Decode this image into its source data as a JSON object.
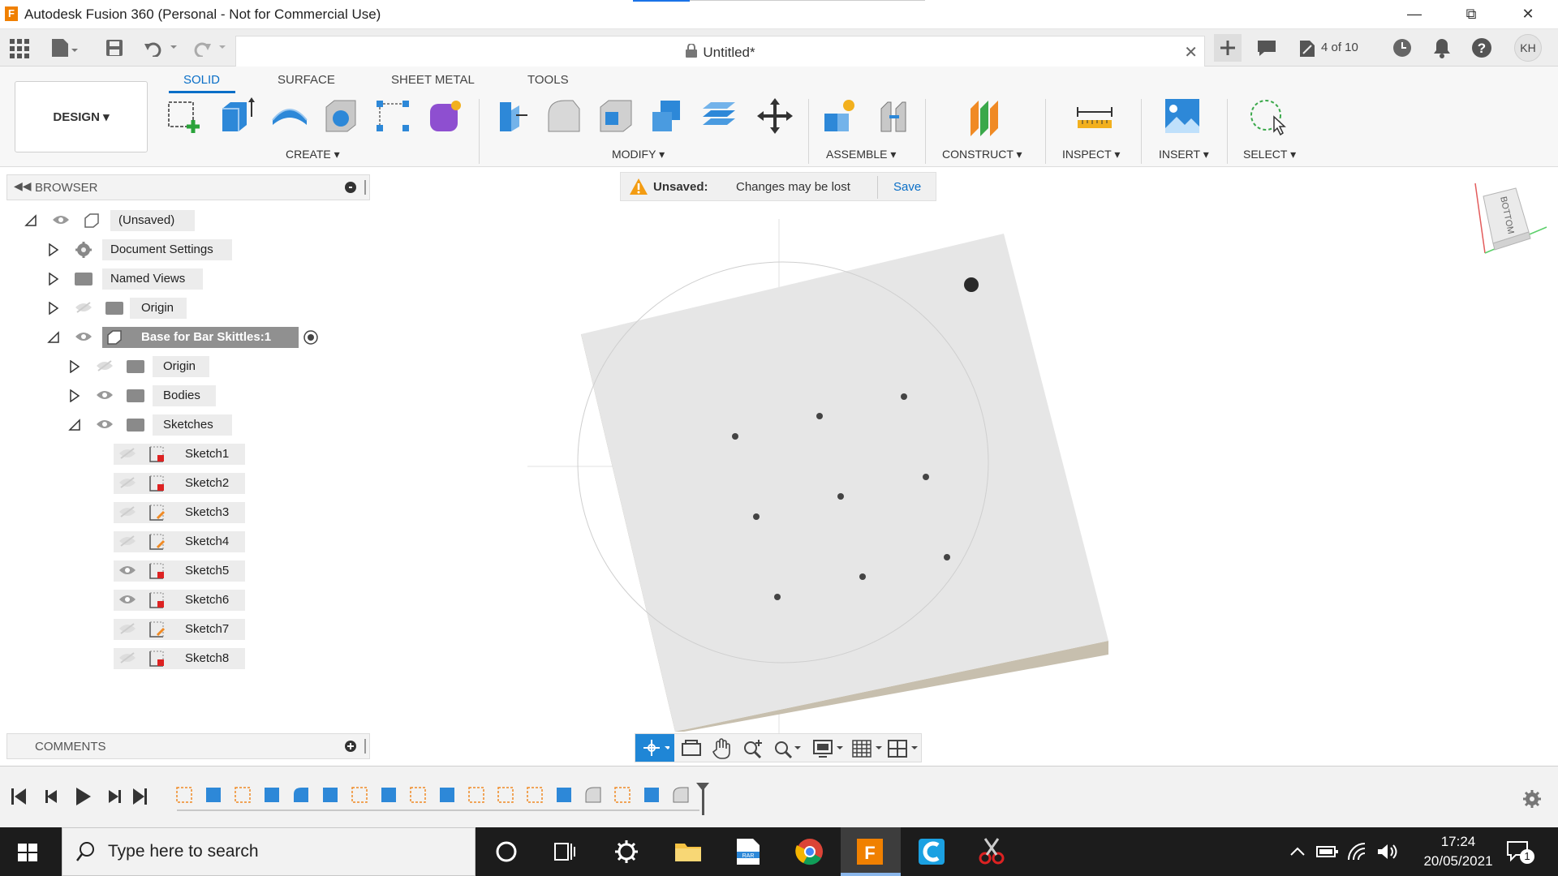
{
  "window": {
    "title": "Autodesk Fusion 360 (Personal - Not for Commercial Use)",
    "app_icon_letter": "F"
  },
  "quickbar": {
    "doc_title": "Untitled*",
    "version": "4 of 10",
    "user_initials": "KH"
  },
  "ribbon": {
    "workspace": "DESIGN",
    "tabs": [
      "SOLID",
      "SURFACE",
      "SHEET METAL",
      "TOOLS"
    ],
    "active_tab": "SOLID",
    "groups": [
      "CREATE",
      "MODIFY",
      "ASSEMBLE",
      "CONSTRUCT",
      "INSPECT",
      "INSERT",
      "SELECT"
    ]
  },
  "browser": {
    "title": "BROWSER",
    "items": [
      {
        "label": "(Unsaved)"
      },
      {
        "label": "Document Settings"
      },
      {
        "label": "Named Views"
      },
      {
        "label": "Origin"
      },
      {
        "label": "Base for Bar Skittles:1"
      },
      {
        "label": "Origin"
      },
      {
        "label": "Bodies"
      },
      {
        "label": "Sketches"
      },
      {
        "label": "Sketch1"
      },
      {
        "label": "Sketch2"
      },
      {
        "label": "Sketch3"
      },
      {
        "label": "Sketch4"
      },
      {
        "label": "Sketch5"
      },
      {
        "label": "Sketch6"
      },
      {
        "label": "Sketch7"
      },
      {
        "label": "Sketch8"
      }
    ]
  },
  "comments": {
    "title": "COMMENTS"
  },
  "unsaved_bar": {
    "status": "Unsaved:",
    "message": "Changes may be lost",
    "save_label": "Save"
  },
  "viewcube": {
    "face": "BOTTOM"
  },
  "taskbar": {
    "search_placeholder": "Type here to search",
    "time": "17:24",
    "date": "20/05/2021",
    "notification_count": "1"
  },
  "colors": {
    "accent": "#0a6fc7",
    "model_top": "#e6e6e6",
    "model_edge": "#bdb5a5"
  }
}
